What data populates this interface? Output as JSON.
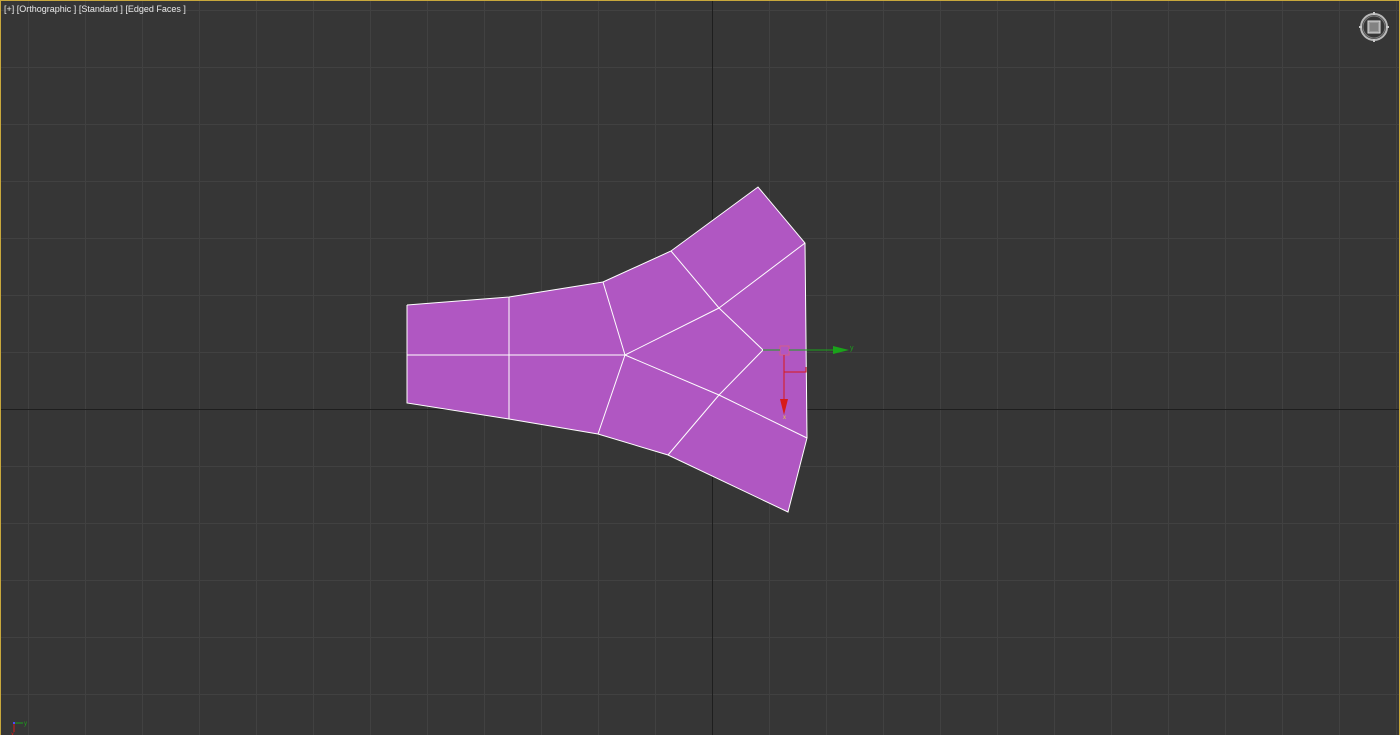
{
  "viewport": {
    "menu_label": "[+]",
    "view_label": "[Orthographic ]",
    "shading_label": "[Standard ]",
    "display_label": "[Edged Faces ]"
  },
  "gizmo": {
    "y_axis_label": "y",
    "x_axis_label": "x"
  },
  "corner_axis": {
    "y_label": "y",
    "x_label": "x"
  },
  "colors": {
    "background": "#363636",
    "grid_minor": "#414141",
    "grid_major": "#1e1e1e",
    "frame_border": "#c8a83c",
    "mesh_fill": "#b057c2",
    "mesh_edges": "#ffffff",
    "gizmo_y": "#1aa31a",
    "gizmo_x": "#d81a1a"
  },
  "icons": {
    "viewcube": "viewcube-icon",
    "gizmo": "move-gizmo-icon",
    "corner_axis": "axis-tripod-icon"
  }
}
